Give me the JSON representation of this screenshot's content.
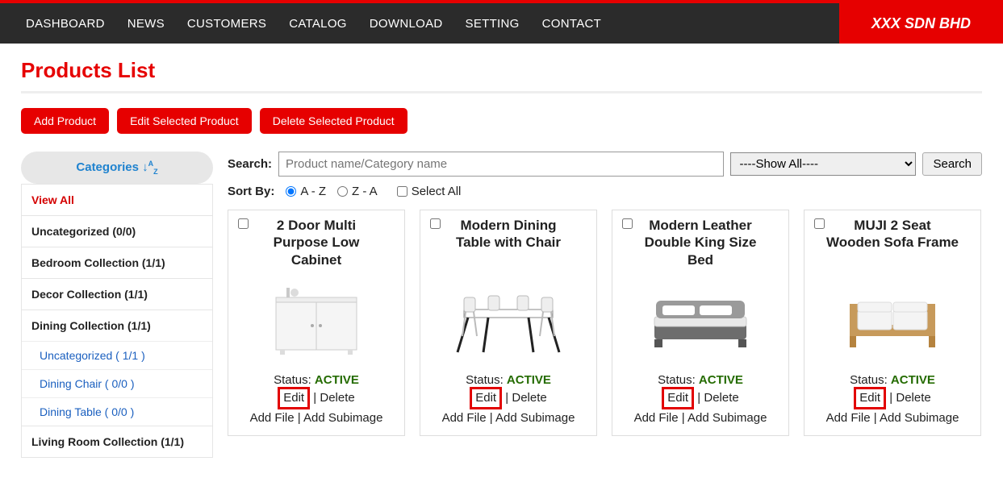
{
  "brand": "XXX SDN BHD",
  "nav": [
    "DASHBOARD",
    "NEWS",
    "CUSTOMERS",
    "CATALOG",
    "DOWNLOAD",
    "SETTING",
    "CONTACT"
  ],
  "pageTitle": "Products List",
  "buttons": {
    "add": "Add Product",
    "editSel": "Edit Selected Product",
    "delSel": "Delete Selected Product"
  },
  "sidebar": {
    "header": "Categories",
    "items": [
      {
        "label": "View All",
        "red": true
      },
      {
        "label": "Uncategorized (0/0)"
      },
      {
        "label": "Bedroom Collection (1/1)"
      },
      {
        "label": "Decor Collection (1/1)"
      },
      {
        "label": "Dining Collection (1/1)"
      },
      {
        "label": "Uncategorized ( 1/1 )",
        "sub": true
      },
      {
        "label": "Dining Chair ( 0/0 )",
        "sub": true
      },
      {
        "label": "Dining Table ( 0/0 )",
        "sub": true
      },
      {
        "label": "Living Room Collection (1/1)"
      }
    ]
  },
  "search": {
    "label": "Search:",
    "placeholder": "Product name/Category name",
    "selectValue": "----Show All----",
    "btn": "Search"
  },
  "sort": {
    "label": "Sort By:",
    "az": "A - Z",
    "za": "Z - A",
    "all": "Select All"
  },
  "statusLabel": "Status:",
  "statusValue": "ACTIVE",
  "actions": {
    "edit": "Edit",
    "delete": "Delete",
    "addfile": "Add File",
    "addsub": "Add Subimage"
  },
  "products": [
    {
      "title": "2 Door Multi Purpose Low Cabinet"
    },
    {
      "title": "Modern Dining Table with Chair"
    },
    {
      "title": "Modern Leather Double King Size Bed"
    },
    {
      "title": "MUJI 2 Seat Wooden Sofa Frame"
    }
  ]
}
